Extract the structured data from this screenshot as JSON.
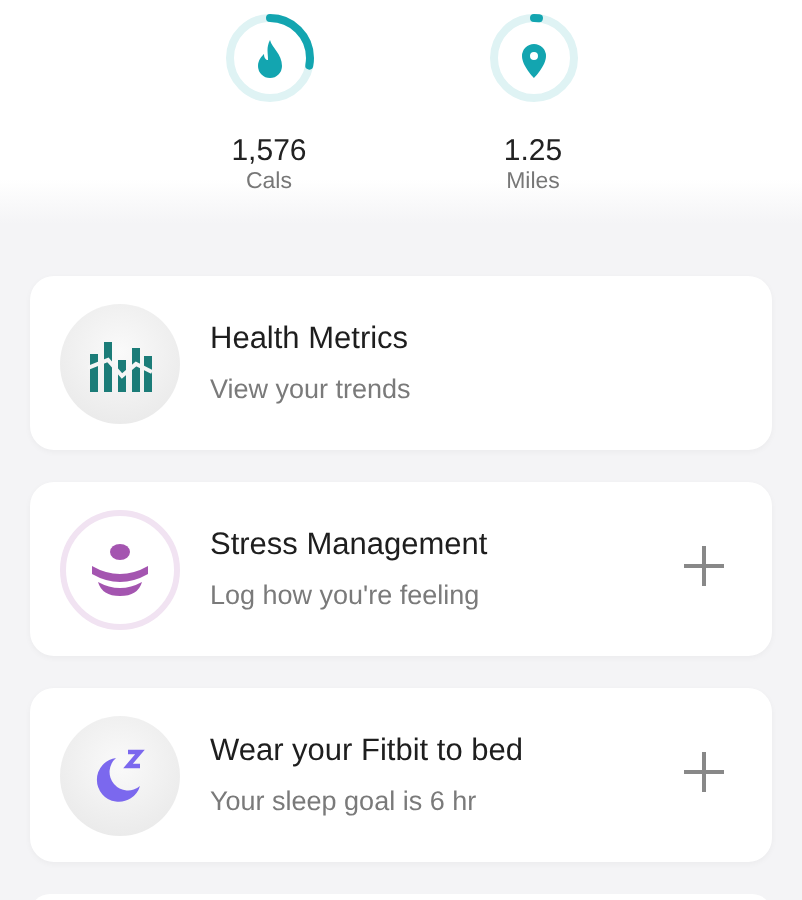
{
  "stats": [
    {
      "kind": "calories",
      "value": "1,576",
      "unit": "Cals",
      "level": 0.28
    },
    {
      "kind": "distance",
      "value": "1.25",
      "unit": "Miles",
      "level": 0.02
    }
  ],
  "cards": [
    {
      "kind": "metrics",
      "title": "Health Metrics",
      "subtitle": "View your trends",
      "add_button": false
    },
    {
      "kind": "stress",
      "title": "Stress Management",
      "subtitle": "Log how you're feeling",
      "add_button": true
    },
    {
      "kind": "sleep",
      "title": "Wear your Fitbit to bed",
      "subtitle": "Your sleep goal is 6 hr",
      "add_button": true
    }
  ]
}
